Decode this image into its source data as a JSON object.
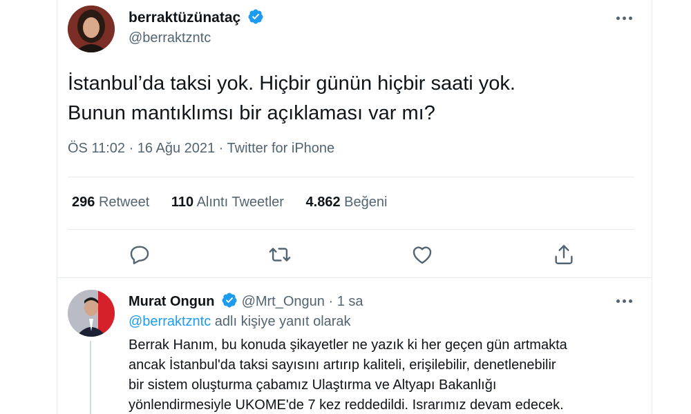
{
  "colors": {
    "accent": "#1d9bf0",
    "text": "#0f1419",
    "muted": "#536471",
    "border": "#e6ecf0"
  },
  "tweet": {
    "display_name": "berraktüzünataç",
    "handle": "@berraktzntc",
    "verified_icon": "verified-badge-icon",
    "text_line1": "İstanbul’da taksi yok. Hiçbir günün hiçbir saati yok.",
    "text_line2": "Bunun mantıklımsı bir açıklaması var mı?",
    "timestamp": "ÖS 11:02 · 16 Ağu 2021 · Twitter for iPhone",
    "stats": {
      "retweets_count": "296",
      "retweets_label": "Retweet",
      "quotes_count": "110",
      "quotes_label": "Alıntı Tweetler",
      "likes_count": "4.862",
      "likes_label": "Beğeni"
    },
    "actions": [
      "reply-icon",
      "retweet-icon",
      "like-icon",
      "share-icon"
    ]
  },
  "reply": {
    "display_name": "Murat Ongun",
    "handle_time": "@Mrt_Ongun · 1 sa",
    "replying_to_handle": "@berraktzntc",
    "replying_to_suffix": " adlı kişiye yanıt olarak",
    "text_lines": [
      "Berrak Hanım, bu konuda şikayetler ne yazık ki her geçen gün artmakta",
      "ancak İstanbul'da taksi sayısını artırıp kaliteli, erişilebilir, denetlenebilir",
      "bir sistem oluşturma çabamız Ulaştırma ve Altyapı Bakanlığı",
      "yönlendirmesiyle UKOME'de 7 kez reddedildi. Israrımız devam edecek."
    ]
  }
}
